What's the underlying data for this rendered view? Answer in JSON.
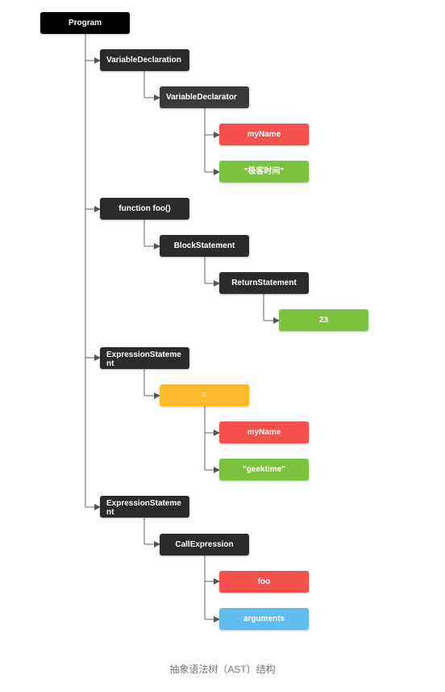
{
  "colors": {
    "black": "#000000",
    "dark": "#2b2b2b",
    "red": "#f5504b",
    "green": "#7cc440",
    "yellow": "#fdb92c",
    "blue": "#5fbdf0",
    "connector": "#555555"
  },
  "nodes": {
    "program": "Program",
    "var_decl": "VariableDeclaration",
    "var_declarator": "VariableDeclarator",
    "myname_1": "myName",
    "str_1": "\"极客时间\"",
    "func_foo": "function foo()",
    "block": "BlockStatement",
    "ret": "ReturnStatement",
    "num_23": "23",
    "expr_1": "ExpressionStatement",
    "assign": "=",
    "myname_2": "myName",
    "str_2": "\"geektime\"",
    "expr_2": "ExpressionStatement",
    "call": "CallExpression",
    "foo": "foo",
    "args": "arguments"
  },
  "caption": "抽象语法树（AST）结构"
}
